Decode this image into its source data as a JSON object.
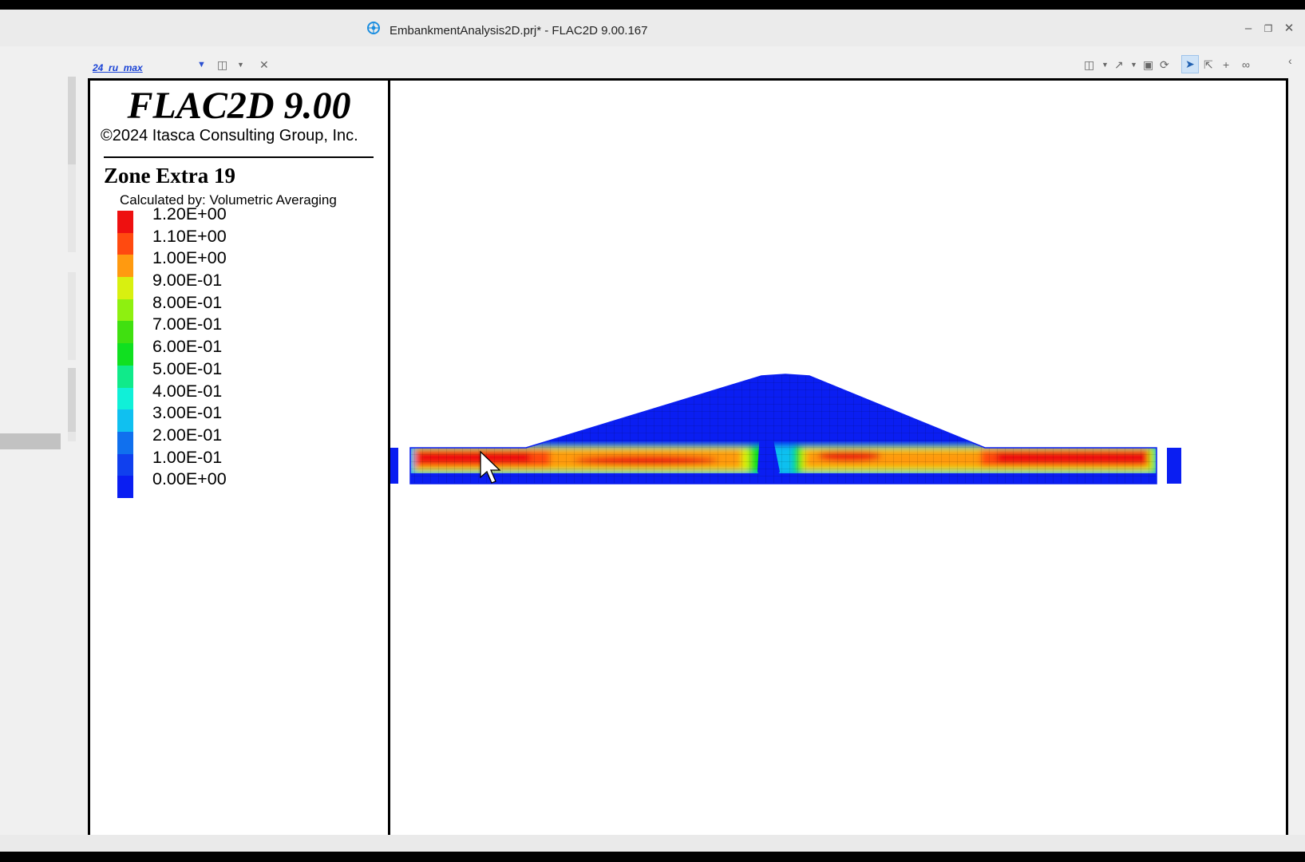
{
  "window": {
    "title": "EmbankmentAnalysis2D.prj* - FLAC2D 9.00.167",
    "app_icon": "flac-app-icon",
    "controls": [
      "minimize-icon",
      "restore-icon",
      "close-icon"
    ]
  },
  "toolbar": {
    "plot_name": "24_ru_max",
    "icons": [
      "dropdown-arrow-icon",
      "split-view-icon",
      "close-icon",
      "panel-layout-icon",
      "export-icon",
      "camera-icon",
      "refresh-icon",
      "select-pointer-icon",
      "select-box-icon",
      "crosshair-icon",
      "link-icon",
      "collapse-left-icon"
    ]
  },
  "legend": {
    "logo": "FLAC2D 9.00",
    "copyright": "©2024 Itasca Consulting Group, Inc.",
    "title": "Zone Extra 19",
    "subtitle": "Calculated by: Volumetric Averaging",
    "entries": [
      {
        "label": "1.20E+00",
        "color": "#ee1010"
      },
      {
        "label": "1.10E+00",
        "color": "#ff4a10"
      },
      {
        "label": "1.00E+00",
        "color": "#ff9a10"
      },
      {
        "label": "9.00E-01",
        "color": "#d8f010"
      },
      {
        "label": "8.00E-01",
        "color": "#8ef010"
      },
      {
        "label": "7.00E-01",
        "color": "#40e010"
      },
      {
        "label": "6.00E-01",
        "color": "#10e020"
      },
      {
        "label": "5.00E-01",
        "color": "#10ea8a"
      },
      {
        "label": "4.00E-01",
        "color": "#10f0d8"
      },
      {
        "label": "3.00E-01",
        "color": "#10c0f0"
      },
      {
        "label": "2.00E-01",
        "color": "#1070ee"
      },
      {
        "label": "1.00E-01",
        "color": "#1040ee"
      },
      {
        "label": "0.00E+00",
        "color": "#0a1ef2"
      }
    ]
  },
  "colors": {
    "low": "#0a1ef2",
    "high": "#ee1010",
    "grid_line": "#000000"
  }
}
